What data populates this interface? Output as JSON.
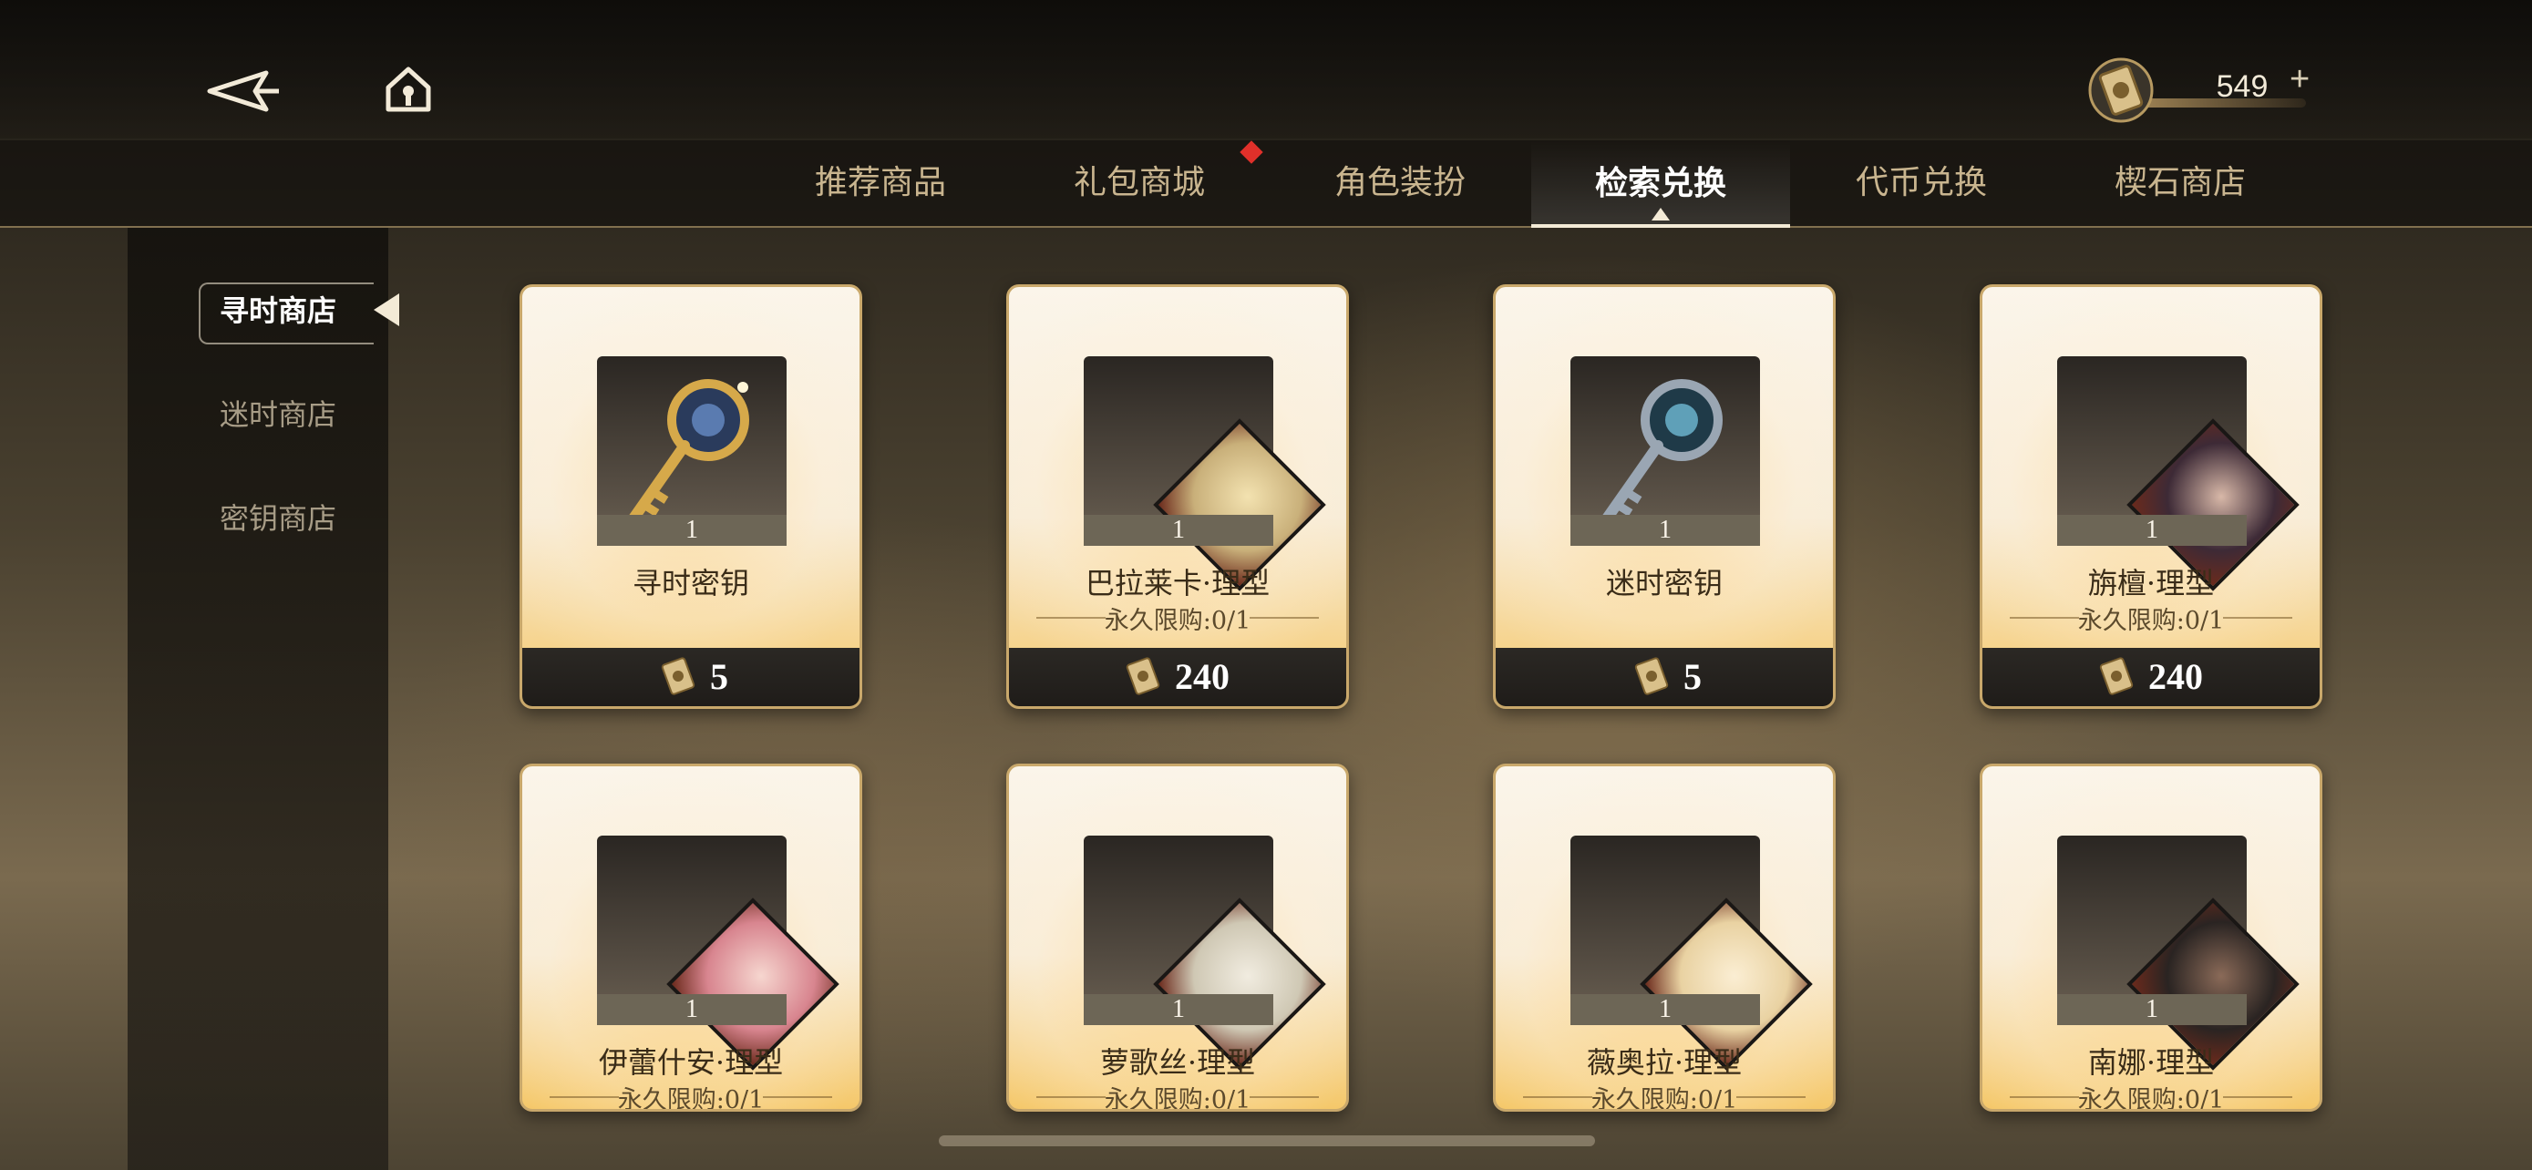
{
  "header": {
    "back_icon": "back-arrow-icon",
    "home_icon": "home-icon",
    "currency": {
      "icon": "ticket-coin-icon",
      "amount": "549",
      "plus": "+"
    }
  },
  "tabs": [
    {
      "label": "推荐商品",
      "active": false
    },
    {
      "label": "礼包商城",
      "active": false,
      "badge": true
    },
    {
      "label": "角色装扮",
      "active": false
    },
    {
      "label": "检索兑换",
      "active": true
    },
    {
      "label": "代币兑换",
      "active": false
    },
    {
      "label": "楔石商店",
      "active": false
    }
  ],
  "sidebar": {
    "items": [
      {
        "label": "寻时商店",
        "active": true
      },
      {
        "label": "迷时商店",
        "active": false
      },
      {
        "label": "密钥商店",
        "active": false
      }
    ]
  },
  "cards": [
    {
      "name": "寻时密钥",
      "qty": "1",
      "limit": "",
      "price": "5",
      "kind": "gold-key",
      "portrait": ""
    },
    {
      "name": "巴拉莱卡·理型",
      "qty": "1",
      "limit": "永久限购:0/1",
      "price": "240",
      "kind": "character",
      "portrait": "#c9b07a"
    },
    {
      "name": "迷时密钥",
      "qty": "1",
      "limit": "",
      "price": "5",
      "kind": "silver-key",
      "portrait": ""
    },
    {
      "name": "旃檀·理型",
      "qty": "1",
      "limit": "永久限购:0/1",
      "price": "240",
      "kind": "character",
      "portrait": "#3d2a36"
    },
    {
      "name": "伊蕾什安·理型",
      "qty": "1",
      "limit": "永久限购:0/1",
      "price": "",
      "kind": "character",
      "portrait": "#d8858f"
    },
    {
      "name": "萝歌丝·理型",
      "qty": "1",
      "limit": "永久限购:0/1",
      "price": "",
      "kind": "character",
      "portrait": "#cfc8b4"
    },
    {
      "name": "薇奥拉·理型",
      "qty": "1",
      "limit": "永久限购:0/1",
      "price": "",
      "kind": "character",
      "portrait": "#e9d2a2"
    },
    {
      "name": "南娜·理型",
      "qty": "1",
      "limit": "永久限购:0/1",
      "price": "",
      "kind": "character",
      "portrait": "#2a2422"
    }
  ],
  "colors": {
    "accent_red": "#e0302a",
    "card_gold": "#f5c86a",
    "tab_active": "#ffffff",
    "tab_inactive": "#c9b58f"
  }
}
